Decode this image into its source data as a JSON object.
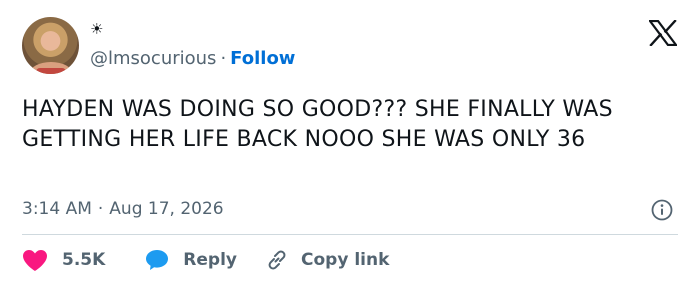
{
  "user": {
    "display_symbol": "☀",
    "handle": "@lmsocurious",
    "separator": "·",
    "follow_label": "Follow"
  },
  "tweet": {
    "text": "HAYDEN WAS DOING SO GOOD??? SHE FINALLY WAS GETTING HER LIFE BACK NOOO SHE WAS ONLY 36",
    "time": "3:14 AM",
    "separator": "·",
    "date": "Aug 17, 2026"
  },
  "actions": {
    "like_count": "5.5K",
    "reply_label": "Reply",
    "copy_link_label": "Copy link"
  },
  "colors": {
    "like": "#f91880",
    "reply": "#1d9bf0",
    "follow": "#006fd6",
    "muted": "#536471"
  },
  "icons": [
    "x-logo-icon",
    "info-icon",
    "heart-icon",
    "speech-bubble-icon",
    "link-icon"
  ]
}
